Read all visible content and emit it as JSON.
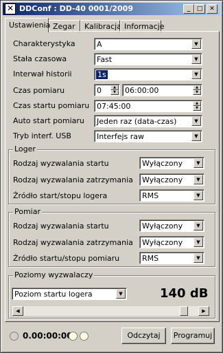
{
  "window": {
    "title": "DDConf : DD-40 0001/2009",
    "minimize_glyph": "_",
    "maximize_glyph": "□",
    "close_glyph": "✕"
  },
  "tabs": [
    "Ustawienia",
    "Zegar",
    "Kalibracja",
    "Informacje"
  ],
  "settings": {
    "charakterystyka": {
      "label": "Charakterystyka",
      "value": "A"
    },
    "stala_czasowa": {
      "label": "Stała czasowa",
      "value": "Fast"
    },
    "interwal": {
      "label": "Interwał historii",
      "value": "1s"
    },
    "czas_pomiaru": {
      "label": "Czas pomiaru",
      "days": "0",
      "time": "06:00:00"
    },
    "czas_startu": {
      "label": "Czas startu pomiaru",
      "value": "07:45:00"
    },
    "auto_start": {
      "label": "Auto start pomiaru",
      "value": "Jeden raz (data-czas)"
    },
    "tryb_usb": {
      "label": "Tryb interf. USB",
      "value": "Interfejs raw"
    }
  },
  "loger": {
    "title": "Loger",
    "rows": [
      {
        "label": "Rodzaj wyzwalania startu",
        "value": "Wyłączony"
      },
      {
        "label": "Rodzaj wyzwalania zatrzymania",
        "value": "Wyłączony"
      },
      {
        "label": "Źródło start/stopu logera",
        "value": "RMS"
      }
    ]
  },
  "pomiar": {
    "title": "Pomiar",
    "rows": [
      {
        "label": "Rodzaj wyzwalania startu",
        "value": "Wyłączony"
      },
      {
        "label": "Rodzaj wyzwalania zatrzymania",
        "value": "Wyłączony"
      },
      {
        "label": "Źródło startu/stopu pomiaru",
        "value": "RMS"
      }
    ]
  },
  "poziomy": {
    "title": "Poziomy wyzwalaczy",
    "selected": "Poziom startu logera",
    "level": "140 dB"
  },
  "status": {
    "time": "0.00:00:00"
  },
  "buttons": {
    "read": "Odczytaj",
    "program": "Programuj"
  },
  "glyphs": {
    "down": "▼",
    "up": "▲",
    "left": "◀",
    "right": "▶"
  },
  "colors": {
    "title_bar_start": "#0a246a",
    "title_bar_end": "#a6caf0",
    "face": "#d4d0c8",
    "selection": "#0a246a"
  }
}
